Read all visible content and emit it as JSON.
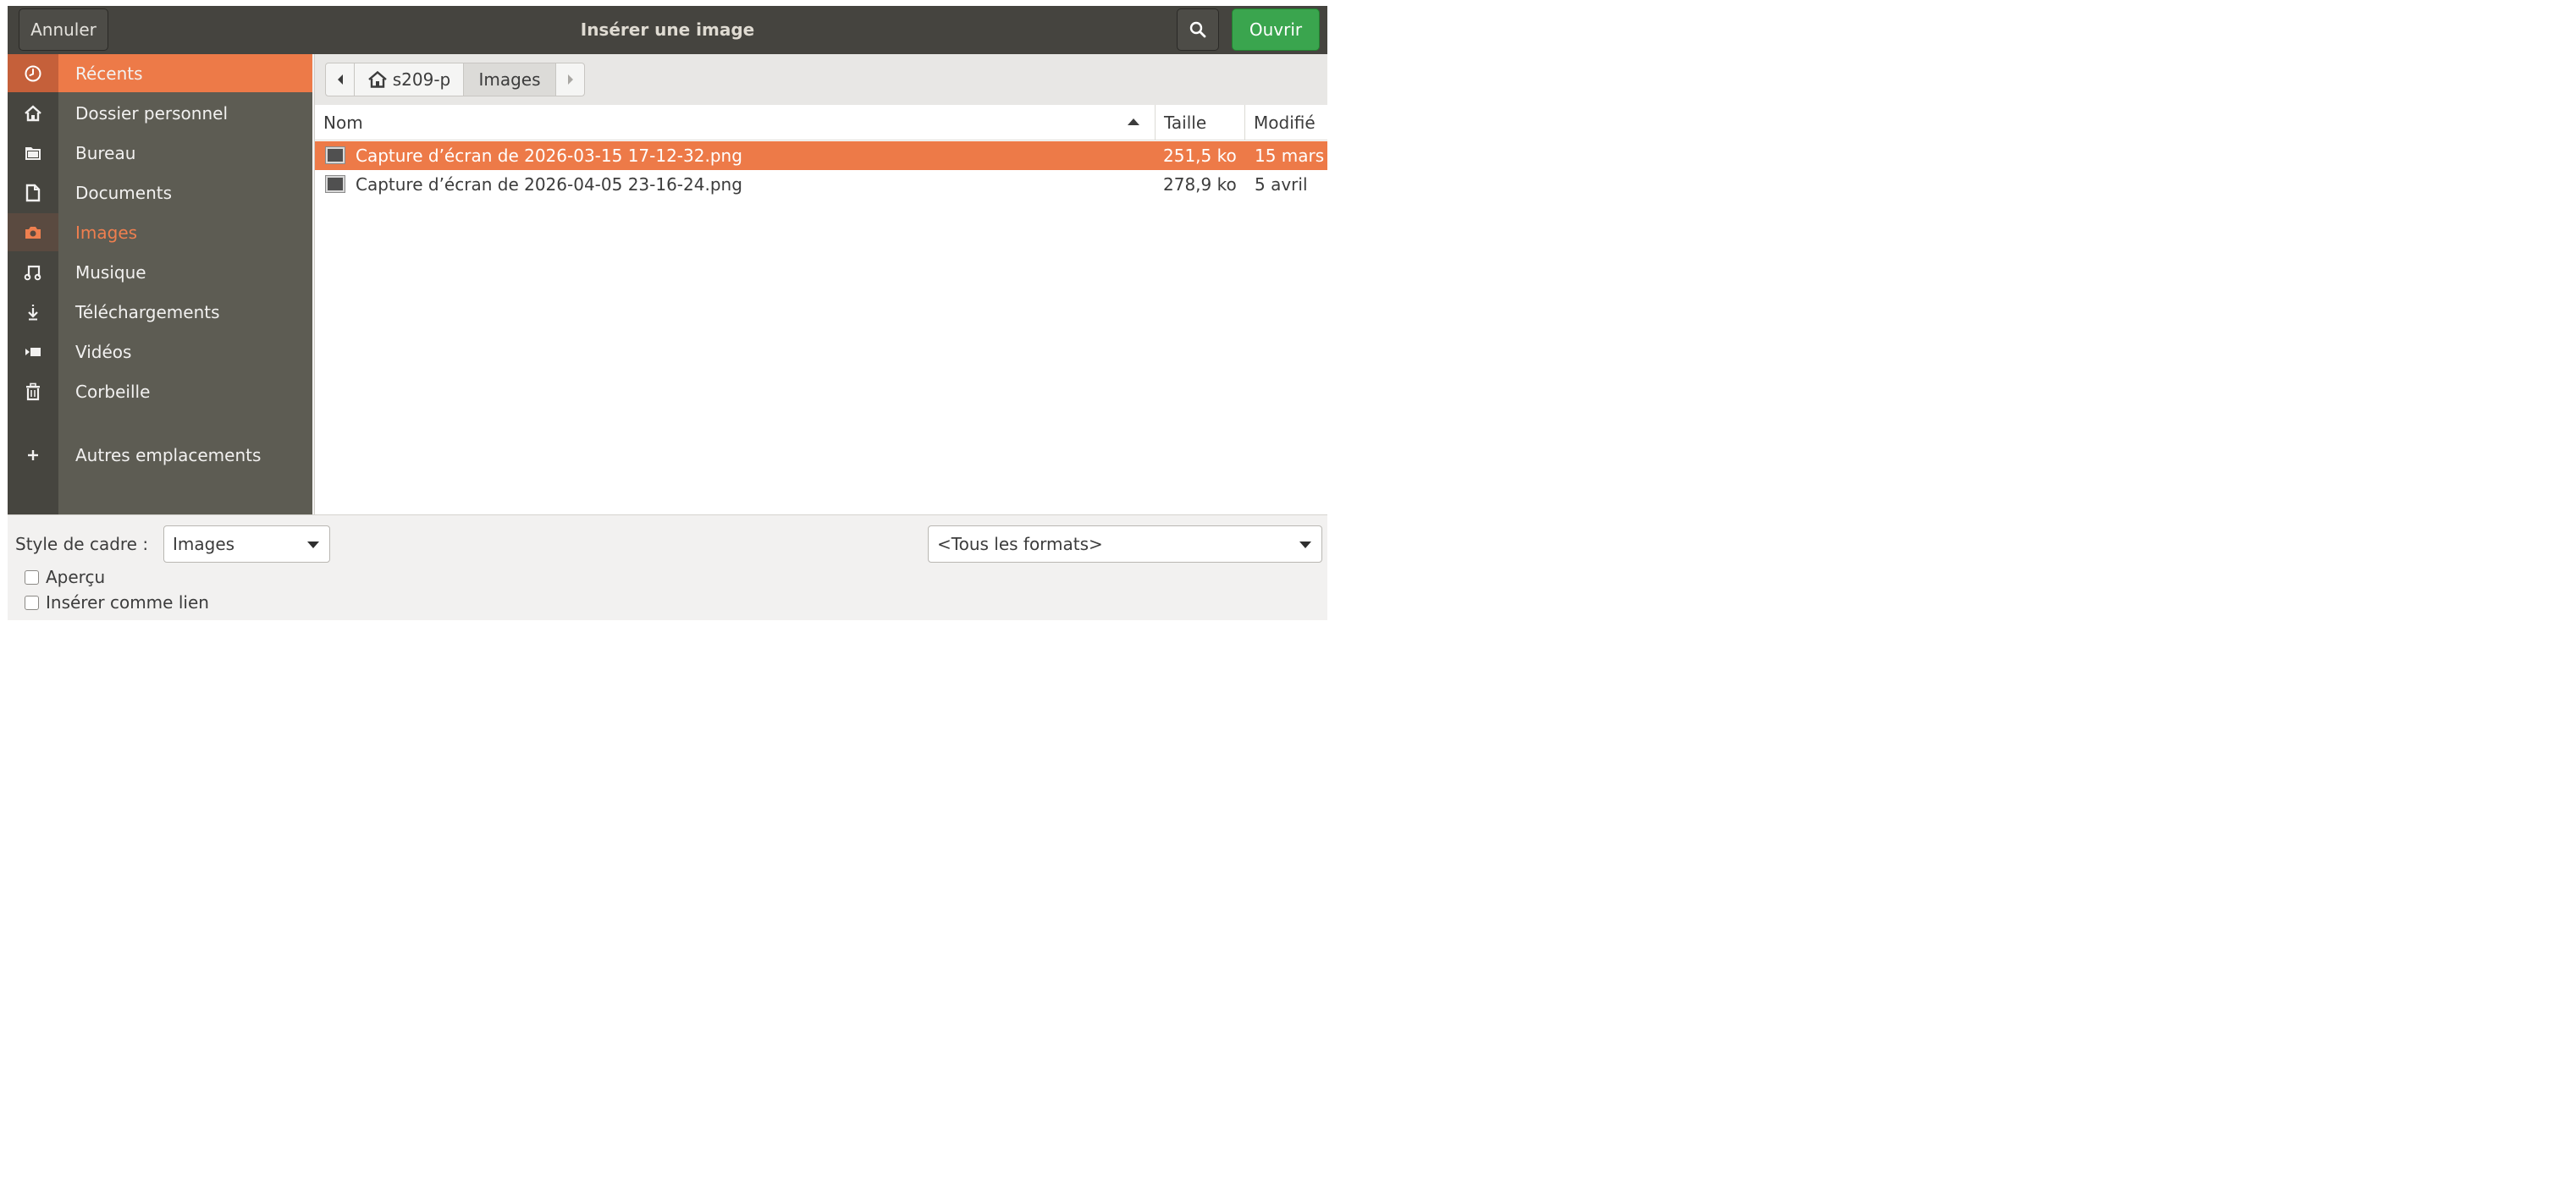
{
  "header": {
    "title": "Insérer une image",
    "cancel_label": "Annuler",
    "open_label": "Ouvrir"
  },
  "sidebar": {
    "items": [
      {
        "label": "Récents",
        "icon": "clock-icon"
      },
      {
        "label": "Dossier personnel",
        "icon": "home-icon"
      },
      {
        "label": "Bureau",
        "icon": "folder-icon"
      },
      {
        "label": "Documents",
        "icon": "document-icon"
      },
      {
        "label": "Images",
        "icon": "camera-icon"
      },
      {
        "label": "Musique",
        "icon": "music-icon"
      },
      {
        "label": "Téléchargements",
        "icon": "download-icon"
      },
      {
        "label": "Vidéos",
        "icon": "video-icon"
      },
      {
        "label": "Corbeille",
        "icon": "trash-icon"
      },
      {
        "label": "Autres emplacements",
        "icon": "plus-icon"
      }
    ]
  },
  "pathbar": {
    "home": "s209-p",
    "current": "Images"
  },
  "columns": {
    "name": "Nom",
    "size": "Taille",
    "modified": "Modifié"
  },
  "files": [
    {
      "name": "Capture d’écran de 2026-03-15 17-12-32.png",
      "size": "251,5 ko",
      "modified": "15 mars"
    },
    {
      "name": "Capture d’écran de 2026-04-05 23-16-24.png",
      "size": "278,9 ko",
      "modified": "5 avril"
    }
  ],
  "bottom": {
    "frame_style_label": "Style de cadre :",
    "frame_style_value": "Images",
    "format_value": "<Tous les formats>",
    "preview_label": "Aperçu",
    "insert_link_label": "Insérer comme lien"
  },
  "colors": {
    "accent": "#ed7a48",
    "open_button": "#3aa54e",
    "headerbar": "#45443f",
    "sidebar": "#5d5c53"
  }
}
